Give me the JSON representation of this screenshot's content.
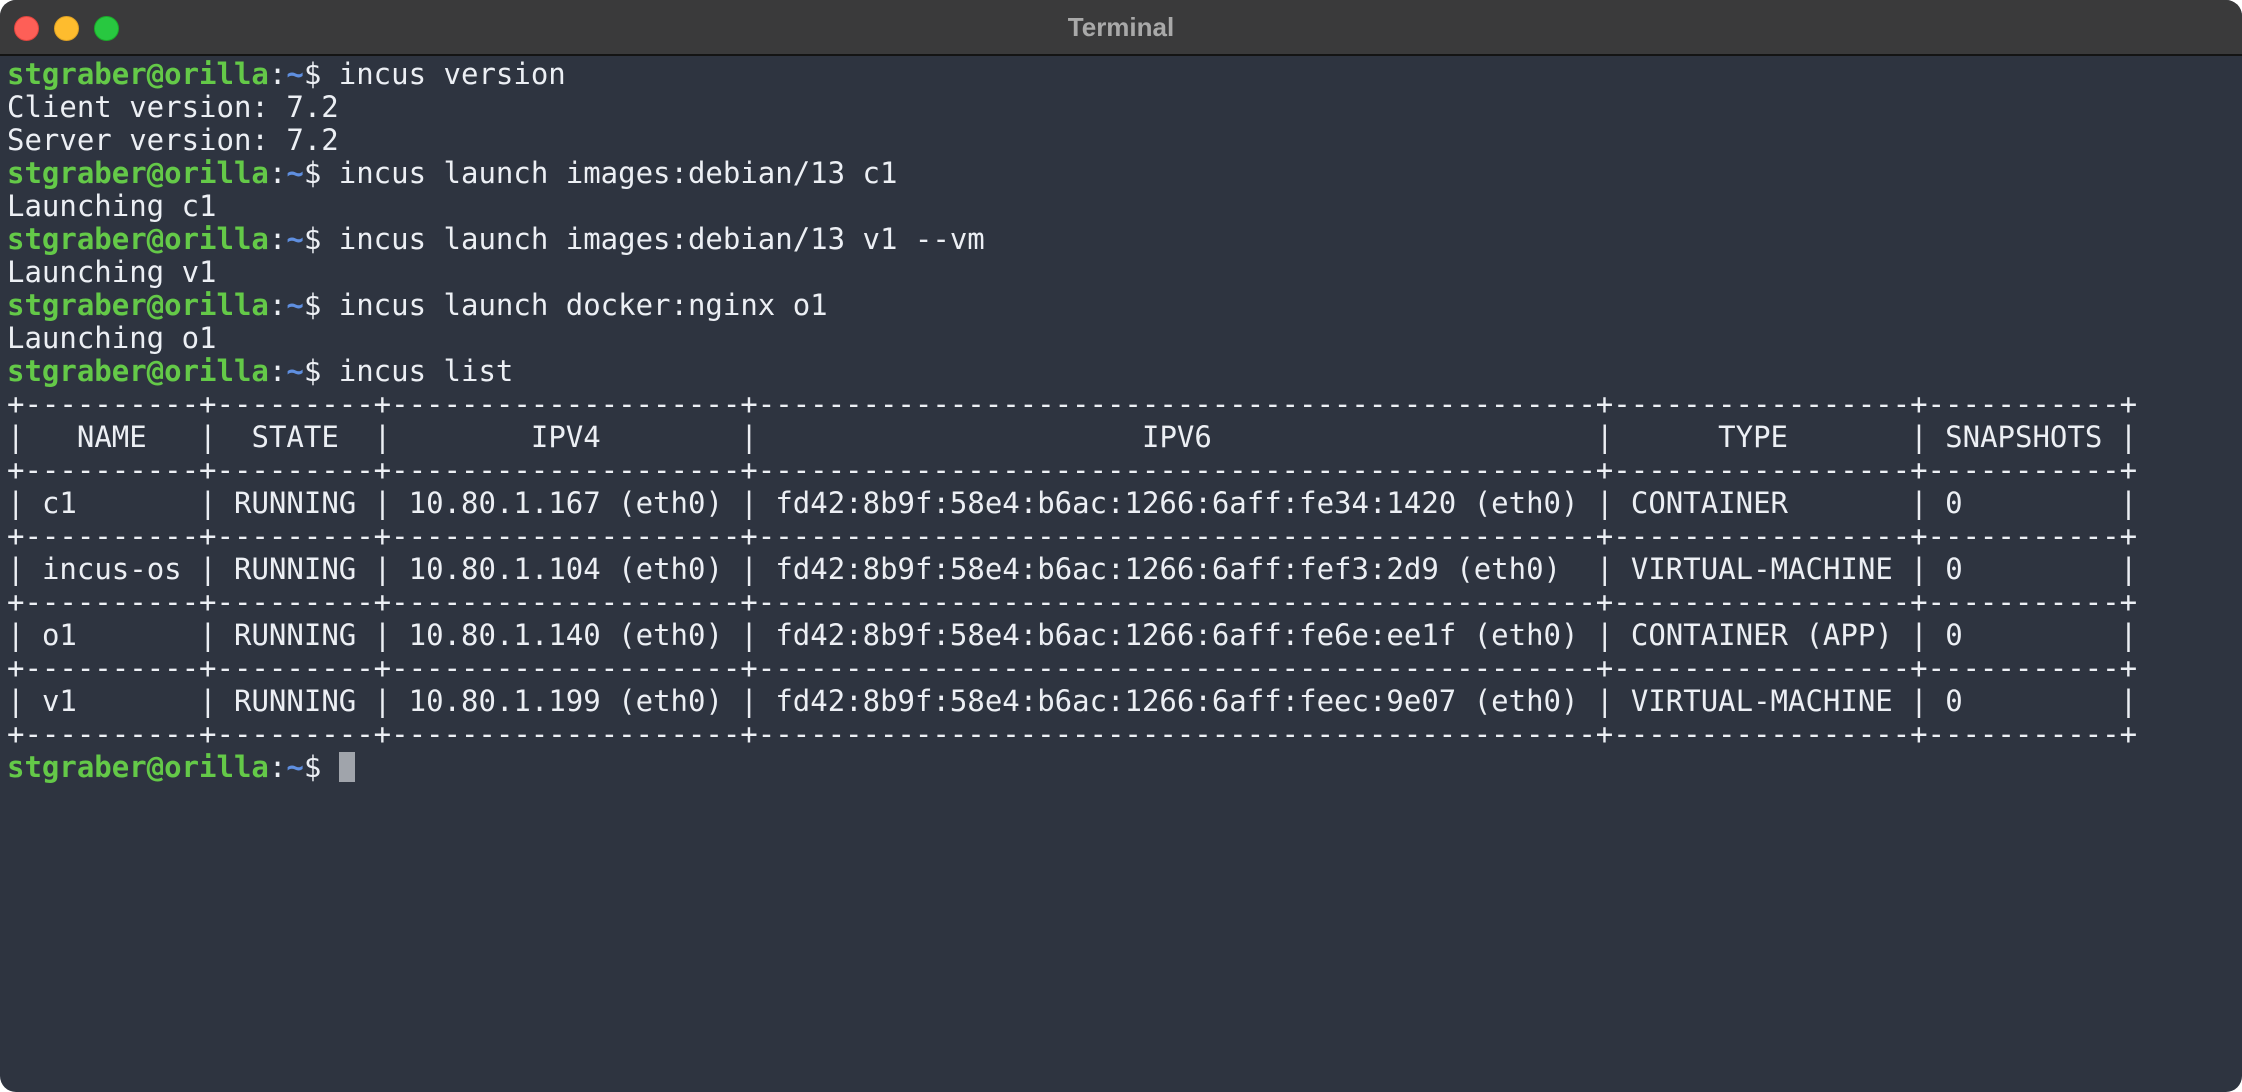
{
  "window": {
    "title": "Terminal"
  },
  "colors": {
    "background": "#2e3440",
    "prompt_user": "#64c948",
    "prompt_path": "#5f8fe0",
    "text": "#eceff4"
  },
  "prompt": {
    "user_host": "stgraber@orilla",
    "colon": ":",
    "path": "~",
    "symbol": "$ "
  },
  "session": [
    {
      "command": "incus version",
      "output": [
        "Client version: 7.2",
        "Server version: 7.2"
      ]
    },
    {
      "command": "incus launch images:debian/13 c1",
      "output": [
        "Launching c1"
      ]
    },
    {
      "command": "incus launch images:debian/13 v1 --vm",
      "output": [
        "Launching v1"
      ]
    },
    {
      "command": "incus launch docker:nginx o1",
      "output": [
        "Launching o1"
      ]
    },
    {
      "command": "incus list",
      "output": []
    }
  ],
  "instance_table": {
    "columns": [
      "NAME",
      "STATE",
      "IPV4",
      "IPV6",
      "TYPE",
      "SNAPSHOTS"
    ],
    "rows": [
      [
        "c1",
        "RUNNING",
        "10.80.1.167 (eth0)",
        "fd42:8b9f:58e4:b6ac:1266:6aff:fe34:1420 (eth0)",
        "CONTAINER",
        "0"
      ],
      [
        "incus-os",
        "RUNNING",
        "10.80.1.104 (eth0)",
        "fd42:8b9f:58e4:b6ac:1266:6aff:fef3:2d9 (eth0)",
        "VIRTUAL-MACHINE",
        "0"
      ],
      [
        "o1",
        "RUNNING",
        "10.80.1.140 (eth0)",
        "fd42:8b9f:58e4:b6ac:1266:6aff:fe6e:ee1f (eth0)",
        "CONTAINER (APP)",
        "0"
      ],
      [
        "v1",
        "RUNNING",
        "10.80.1.199 (eth0)",
        "fd42:8b9f:58e4:b6ac:1266:6aff:feec:9e07 (eth0)",
        "VIRTUAL-MACHINE",
        "0"
      ]
    ]
  },
  "current_input": ""
}
